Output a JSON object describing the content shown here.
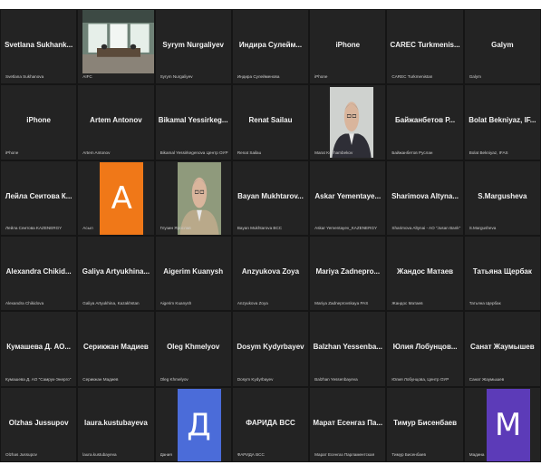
{
  "meeting": {
    "tiles": [
      {
        "center": "Svetlana Sukhank...",
        "label": "Svetlana Sukhanova"
      },
      {
        "center": "",
        "label": "AIFC",
        "kind": "video-room"
      },
      {
        "center": "Syrym Nurgaliyev",
        "label": "Syrym Nurgaliyev"
      },
      {
        "center": "Индира Сулейм...",
        "label": "Индира Сулейменова"
      },
      {
        "center": "iPhone",
        "label": "iPhone"
      },
      {
        "center": "CAREC Turkmenis...",
        "label": "CAREC Turkmenistan"
      },
      {
        "center": "Galym",
        "label": "Galym"
      },
      {
        "center": "iPhone",
        "label": "iPhone"
      },
      {
        "center": "Artem Antonov",
        "label": "Artem Antonov"
      },
      {
        "center": "Bikamal Yessirkeg...",
        "label": "Bikamal Yessirkegenova Центр ОУР"
      },
      {
        "center": "Renat Sailau",
        "label": "Renat Sailau"
      },
      {
        "center": "",
        "label": "Marat Kozhambekov",
        "kind": "video-man1"
      },
      {
        "center": "Байжанбетов Р...",
        "label": "Байжанбетов Руслан"
      },
      {
        "center": "Bolat Bekniyaz, IF...",
        "label": "Bolat Bekniyaz, IFAS"
      },
      {
        "center": "Лейла Сеитова К...",
        "label": "Лейла Сеитова KAZENERGY"
      },
      {
        "center": "",
        "label": "Асыл",
        "kind": "avatar",
        "letter": "A",
        "color": "#f07818"
      },
      {
        "center": "",
        "label": "Глузин Ярослав",
        "kind": "video-man2"
      },
      {
        "center": "Bayan Mukhtarov...",
        "label": "Bayan Mukhtarova BCC"
      },
      {
        "center": "Askar Yementaye...",
        "label": "Askar Yementayev_KAZENERGY"
      },
      {
        "center": "Sharimova Altyna...",
        "label": "Sharimova Altynai - AO \"Jusan Bank\""
      },
      {
        "center": "S.Margusheva",
        "label": "S.Margusheva"
      },
      {
        "center": "Alexandra Chikid...",
        "label": "Alexandra Chikidova"
      },
      {
        "center": "Galiya Artyukhina...",
        "label": "Galiya Artyukhina, Kazakhstan"
      },
      {
        "center": "Aigerim Kuanysh",
        "label": "Aigerim Kuanysh"
      },
      {
        "center": "Anzyukova Zoya",
        "label": "Anzyukova Zoya"
      },
      {
        "center": "Mariya Zadnepro...",
        "label": "Mariya Zadneprovskaya PAS"
      },
      {
        "center": "Жандос Матаев",
        "label": "Жандос Матаев"
      },
      {
        "center": "Татьяна Щербак",
        "label": "Татьяна Щербак"
      },
      {
        "center": "Кумашева Д. АО...",
        "label": "Кумашева Д. АО \"Самрук-Энерго\""
      },
      {
        "center": "Серикжан Мадиев",
        "label": "Серикжан Мадиев"
      },
      {
        "center": "Oleg Khmelyov",
        "label": "Oleg Khmelyov"
      },
      {
        "center": "Dosym Kydyrbayev",
        "label": "Dosym Kydyrbayev"
      },
      {
        "center": "Balzhan Yessenba...",
        "label": "Balzhan Yessenbayeva"
      },
      {
        "center": "Юлия Лобунцов...",
        "label": "Юлия Лобунцова, Центр ОУР"
      },
      {
        "center": "Санат Жаумышев",
        "label": "Санат Жаумышев"
      },
      {
        "center": "Olzhas Jussupov",
        "label": "Olzhas Jussupov"
      },
      {
        "center": "laura.kustubayeva",
        "label": "laura.kustubayeva"
      },
      {
        "center": "",
        "label": "Дания",
        "kind": "avatar",
        "letter": "Д",
        "color": "#4b6cd9"
      },
      {
        "center": "ФАРИДА BCC",
        "label": "ФАРИДА BCC"
      },
      {
        "center": "Марат Есенгаз Па...",
        "label": "Марат Есенгаз Парламентская"
      },
      {
        "center": "Тимур Бисенбаев",
        "label": "Тимур Бисенбаев"
      },
      {
        "center": "",
        "label": "Мадина",
        "kind": "avatar",
        "letter": "M",
        "color": "#5c3bb8"
      }
    ]
  }
}
